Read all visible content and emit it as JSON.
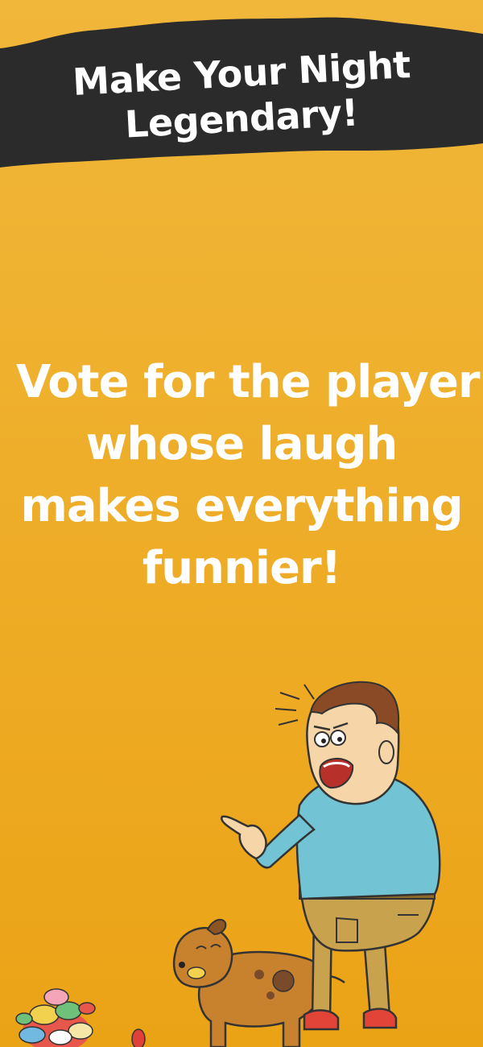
{
  "headline": {
    "line1": "Make Your Night",
    "line2": "Legendary!"
  },
  "prompt": {
    "lines": [
      "Vote for the player",
      "whose laugh",
      "makes everything",
      "funnier!"
    ]
  },
  "colors": {
    "background_top": "#F1B73A",
    "background_bottom": "#EBA316",
    "banner": "#2B2B2B",
    "text": "#FFFFFF",
    "shirt": "#72C3D3",
    "pants": "#C9A24E",
    "dog": "#C8822E"
  },
  "icons": {
    "illustration": "man-pointing-with-dog",
    "candy": "candy-pile"
  }
}
